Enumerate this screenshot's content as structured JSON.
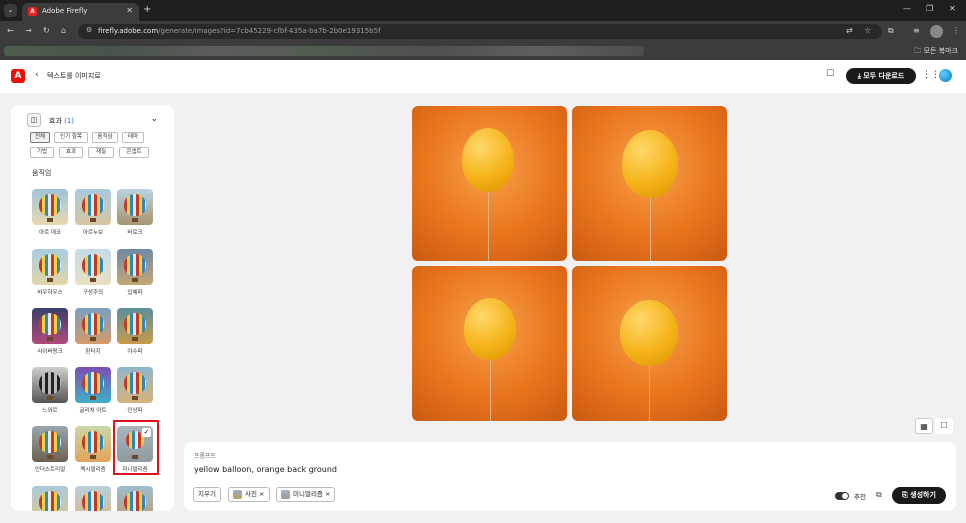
{
  "browser": {
    "tab_title": "Adobe Firefly",
    "tab_close": "✕",
    "new_tab": "+",
    "url_host": "firefly.adobe.com",
    "url_path": "/generate/images?id=7cb45229-cfbf-435a-ba7b-2b0e19315b5f",
    "all_bookmarks": "모든 북마크"
  },
  "app": {
    "title": "텍스트를 이미지로",
    "download_all": "모두 다운로드"
  },
  "effects": {
    "header_label": "효과",
    "count": "(1)",
    "filters": [
      "전체",
      "인기 항목",
      "움직임",
      "테마",
      "기법",
      "효과",
      "재질",
      "콘셉트"
    ],
    "section": "움직임",
    "items": [
      {
        "label": "아르 데코"
      },
      {
        "label": "아르누보"
      },
      {
        "label": "바로크"
      },
      {
        "label": "바우하우스"
      },
      {
        "label": "구성주의"
      },
      {
        "label": "입체파"
      },
      {
        "label": "사이버펑크"
      },
      {
        "label": "판타지"
      },
      {
        "label": "야수파"
      },
      {
        "label": "느와르"
      },
      {
        "label": "글리치 아트"
      },
      {
        "label": "인상파"
      },
      {
        "label": "인더스트리얼"
      },
      {
        "label": "맥시멀리즘"
      },
      {
        "label": "미니멀리즘"
      }
    ],
    "selected_check": "✓"
  },
  "prompt": {
    "label": "프롬프트",
    "text": "yellow balloon, orange back ground",
    "clear": "지우기",
    "tags": [
      {
        "label": "사진"
      },
      {
        "label": "미니멀리즘"
      }
    ],
    "tag_remove": "×",
    "recommend": "추천",
    "generate": "생성하기"
  },
  "colors": {
    "accent_red": "#eb1000",
    "selection_border": "#e0121d",
    "link_blue": "#1473e6",
    "image_orange": "#e9751e",
    "balloon_yellow": "#f5b319"
  }
}
